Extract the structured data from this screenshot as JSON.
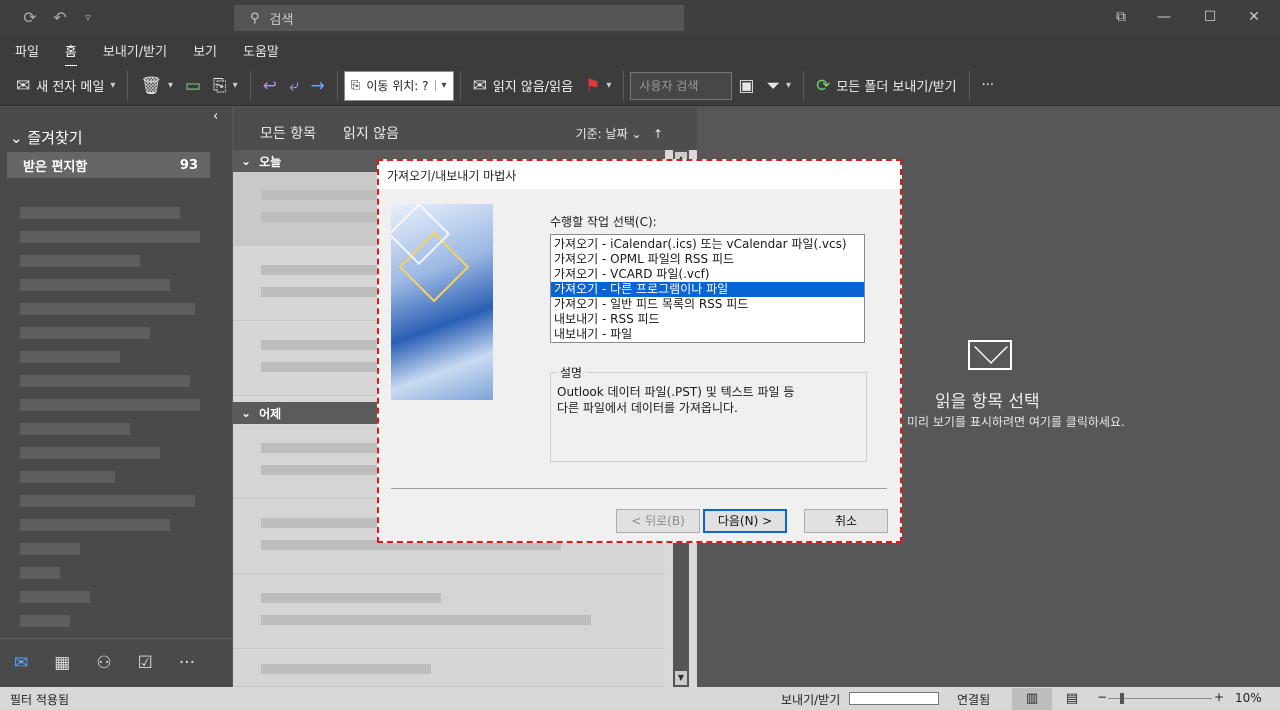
{
  "titlebar": {
    "search_placeholder": "검색",
    "icons": [
      "sync-icon",
      "undo-icon",
      "quick-access-icon"
    ]
  },
  "menu": [
    "파일",
    "홈",
    "보내기/받기",
    "보기",
    "도움말"
  ],
  "ribbon": {
    "new_email": "새 전자 메일",
    "move_to": "이동 위치: ?",
    "read_unread": "읽지 않음/읽음",
    "people_search": "사용자 검색",
    "send_receive_all": "모든 폴더 보내기/받기",
    "more": "···"
  },
  "leftnav": {
    "favorites": "즐겨찾기",
    "inbox_label": "받은 편지함",
    "inbox_count": "93"
  },
  "msglist": {
    "tab_all": "모든 항목",
    "tab_unread": "읽지 않음",
    "sort_label": "기준: 날짜",
    "group_today": "오늘",
    "group_yesterday": "어제"
  },
  "reading": {
    "title": "읽을 항목 선택",
    "subtitle": "미리 보기를 표시하려면 여기를 클릭하세요."
  },
  "statusbar": {
    "filter": "필터 적용됨",
    "send_receive": "보내기/받기",
    "connected": "연결됨",
    "zoom": "10%"
  },
  "dialog": {
    "title": "가져오기/내보내기 마법사",
    "prompt": "수행할 작업 선택(C):",
    "options": [
      "가져오기 - iCalendar(.ics) 또는 vCalendar 파일(.vcs)",
      "가져오기 - OPML 파일의 RSS 피드",
      "가져오기 - VCARD 파일(.vcf)",
      "가져오기 - 다른 프로그램이나 파일",
      "가져오기 - 일반 피드 목록의 RSS 피드",
      "내보내기 - RSS 피드",
      "내보내기 - 파일"
    ],
    "selected_index": 3,
    "desc_label": "설명",
    "desc_text": "Outlook 데이터 파일(.PST) 및 텍스트 파일 등\n다른 파일에서 데이터를 가져옵니다.",
    "back": "< 뒤로(B)",
    "next": "다음(N) >",
    "cancel": "취소"
  }
}
